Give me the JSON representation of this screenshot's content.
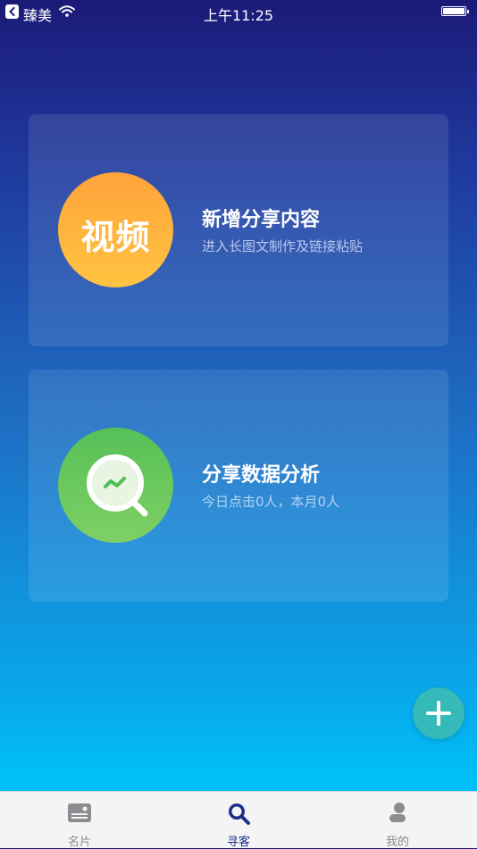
{
  "status_bar": {
    "back_app": "臻美",
    "time": "上午11:25"
  },
  "cards": [
    {
      "icon_text": "视频",
      "title": "新增分享内容",
      "subtitle": "进入长图文制作及链接粘贴",
      "icon_color": "#ffb03d"
    },
    {
      "title": "分享数据分析",
      "subtitle": "今日点击0人，本月0人",
      "icon_color": "#66c85b"
    }
  ],
  "fab": {
    "icon": "plus-icon",
    "color": "#35b9b9"
  },
  "tab_bar": {
    "active_color": "#1c2f8a",
    "items": [
      {
        "label": "名片",
        "icon": "business-card-icon"
      },
      {
        "label": "寻客",
        "icon": "search-icon"
      },
      {
        "label": "我的",
        "icon": "user-icon"
      }
    ]
  }
}
